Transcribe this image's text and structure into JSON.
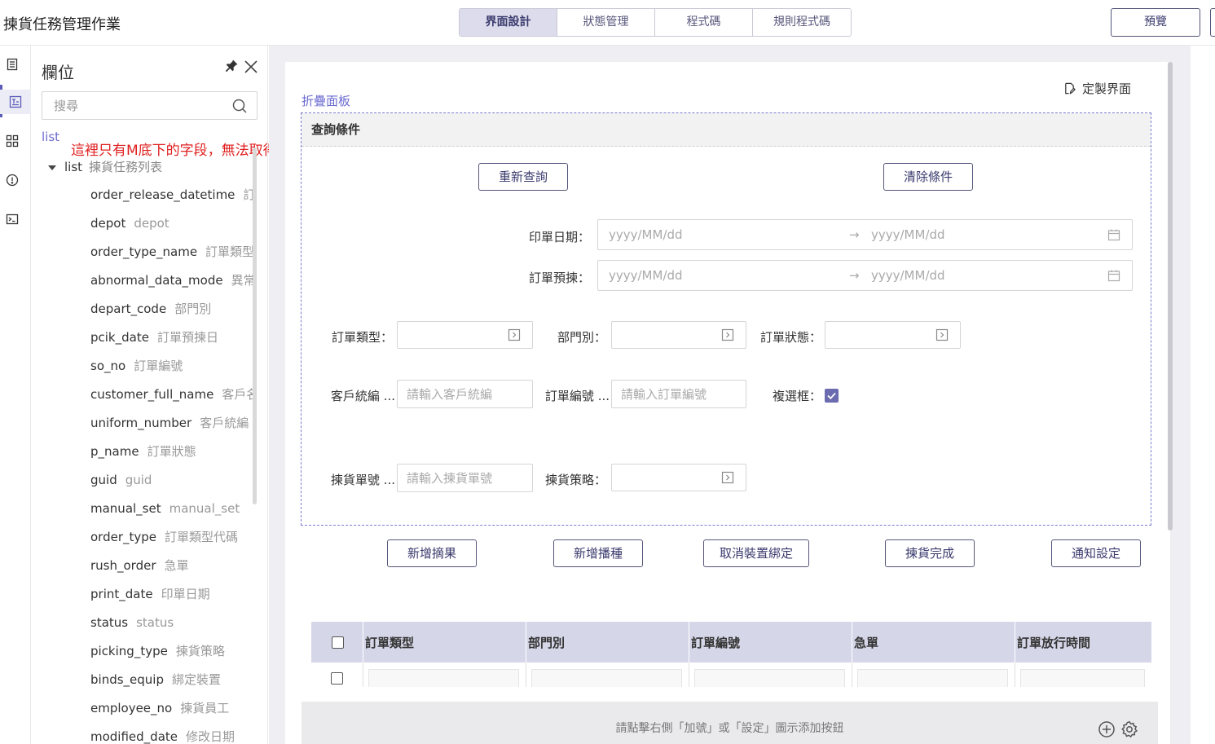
{
  "app": {
    "title": "揀貨任務管理作業"
  },
  "tabs": [
    {
      "label": "界面設計",
      "active": true
    },
    {
      "label": "狀態管理",
      "active": false
    },
    {
      "label": "程式碼",
      "active": false
    },
    {
      "label": "規則程式碼",
      "active": false
    }
  ],
  "toolbar": {
    "preview_label": "預覽"
  },
  "rail": {
    "icons": [
      "page-icon",
      "form-icon",
      "grid-icon",
      "alert-icon",
      "terminal-icon"
    ]
  },
  "fields_panel": {
    "title": "欄位",
    "search_placeholder": "搜尋",
    "root_label": "list",
    "note": "這裡只有M底下的字段，無法取得P字段",
    "tree_root": {
      "name": "list",
      "desc": "揀貨任務列表"
    },
    "items": [
      {
        "name": "order_release_datetime",
        "desc": "訂單放行時間"
      },
      {
        "name": "depot",
        "desc": "depot"
      },
      {
        "name": "order_type_name",
        "desc": "訂單類型"
      },
      {
        "name": "abnormal_data_mode",
        "desc": "異常資料模式"
      },
      {
        "name": "depart_code",
        "desc": "部門別"
      },
      {
        "name": "pcik_date",
        "desc": "訂單預揀日"
      },
      {
        "name": "so_no",
        "desc": "訂單編號"
      },
      {
        "name": "customer_full_name",
        "desc": "客戶名稱"
      },
      {
        "name": "uniform_number",
        "desc": "客戶統編"
      },
      {
        "name": "p_name",
        "desc": "訂單狀態"
      },
      {
        "name": "guid",
        "desc": "guid"
      },
      {
        "name": "manual_set",
        "desc": "manual_set"
      },
      {
        "name": "order_type",
        "desc": "訂單類型代碼"
      },
      {
        "name": "rush_order",
        "desc": "急單"
      },
      {
        "name": "print_date",
        "desc": "印單日期"
      },
      {
        "name": "status",
        "desc": "status"
      },
      {
        "name": "picking_type",
        "desc": "揀貨策略"
      },
      {
        "name": "binds_equip",
        "desc": "綁定裝置"
      },
      {
        "name": "employee_no",
        "desc": "揀貨員工"
      },
      {
        "name": "modified_date",
        "desc": "修改日期"
      }
    ]
  },
  "design": {
    "customize_label": "定製界面",
    "panel_label": "折疊面板",
    "collapse_title": "查詢條件",
    "requery_label": "重新查詢",
    "clear_label": "清除條件",
    "print_date": {
      "label": "印單日期：",
      "start_ph": "yyyy/MM/dd",
      "end_ph": "yyyy/MM/dd"
    },
    "pick_date": {
      "label": "訂單預揀：",
      "start_ph": "yyyy/MM/dd",
      "end_ph": "yyyy/MM/dd"
    },
    "order_type_label": "訂單類型：",
    "depart_label": "部門別：",
    "order_status_label": "訂單狀態：",
    "customer_label": "客戶統編 ...",
    "customer_ph": "請輸入客戶統編",
    "so_no_label": "訂單編號 ...",
    "so_no_ph": "請輸入訂單編號",
    "checkbox_label": "複選框：",
    "checkbox_checked": true,
    "pick_no_label": "揀貨單號 ...",
    "pick_no_ph": "請輸入揀貨單號",
    "strategy_label": "揀貨策略：",
    "actions": [
      "新增摘果",
      "新增播種",
      "取消裝置綁定",
      "揀貨完成",
      "通知設定"
    ]
  },
  "table": {
    "columns": [
      "訂單類型",
      "部門別",
      "訂單編號",
      "急單",
      "訂單放行時間"
    ]
  },
  "button_bar": {
    "hint": "請點擊右側「加號」或「設定」圖示添加按鈕"
  },
  "colors": {
    "accent": "#6b6bd0",
    "tab_active_bg": "#dcdcec",
    "note_red": "#e02020",
    "table_head": "#d5d7e8"
  }
}
